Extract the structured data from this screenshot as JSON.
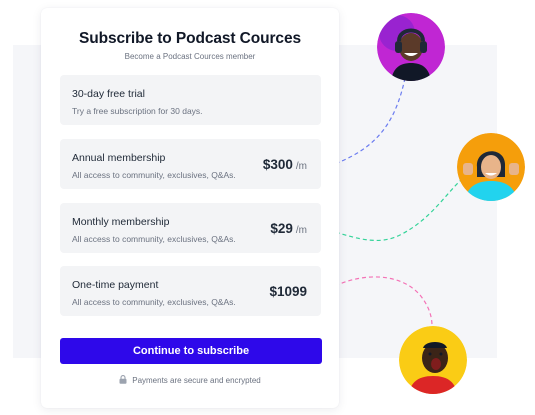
{
  "header": {
    "title": "Subscribe to Podcast Cources",
    "subtitle": "Become a Podcast Cources member"
  },
  "plans": [
    {
      "name": "30-day free trial",
      "description": "Try a free subscription for 30 days.",
      "price": "",
      "unit": ""
    },
    {
      "name": "Annual membership",
      "description": "All access to community, exclusives, Q&As.",
      "price": "$300",
      "unit": "/m"
    },
    {
      "name": "Monthly membership",
      "description": "All access to community, exclusives, Q&As.",
      "price": "$29",
      "unit": "/m"
    },
    {
      "name": "One-time payment",
      "description": "All access to community, exclusives, Q&As.",
      "price": "$1099",
      "unit": ""
    }
  ],
  "cta": {
    "label": "Continue to subscribe"
  },
  "footer": {
    "secure_text": "Payments are secure and encrypted",
    "icon": "lock-icon"
  },
  "colors": {
    "accent": "#2e08ea",
    "option_bg": "#f3f4f6",
    "connector_blue": "#6b7cf0",
    "connector_green": "#34d399",
    "connector_pink": "#f472b6"
  },
  "avatars": [
    {
      "name": "headphones-person-avatar",
      "background": "#c026d3"
    },
    {
      "name": "thumbs-up-person-avatar",
      "background": "#f59e0b"
    },
    {
      "name": "shouting-person-avatar",
      "background": "#facc15"
    }
  ]
}
